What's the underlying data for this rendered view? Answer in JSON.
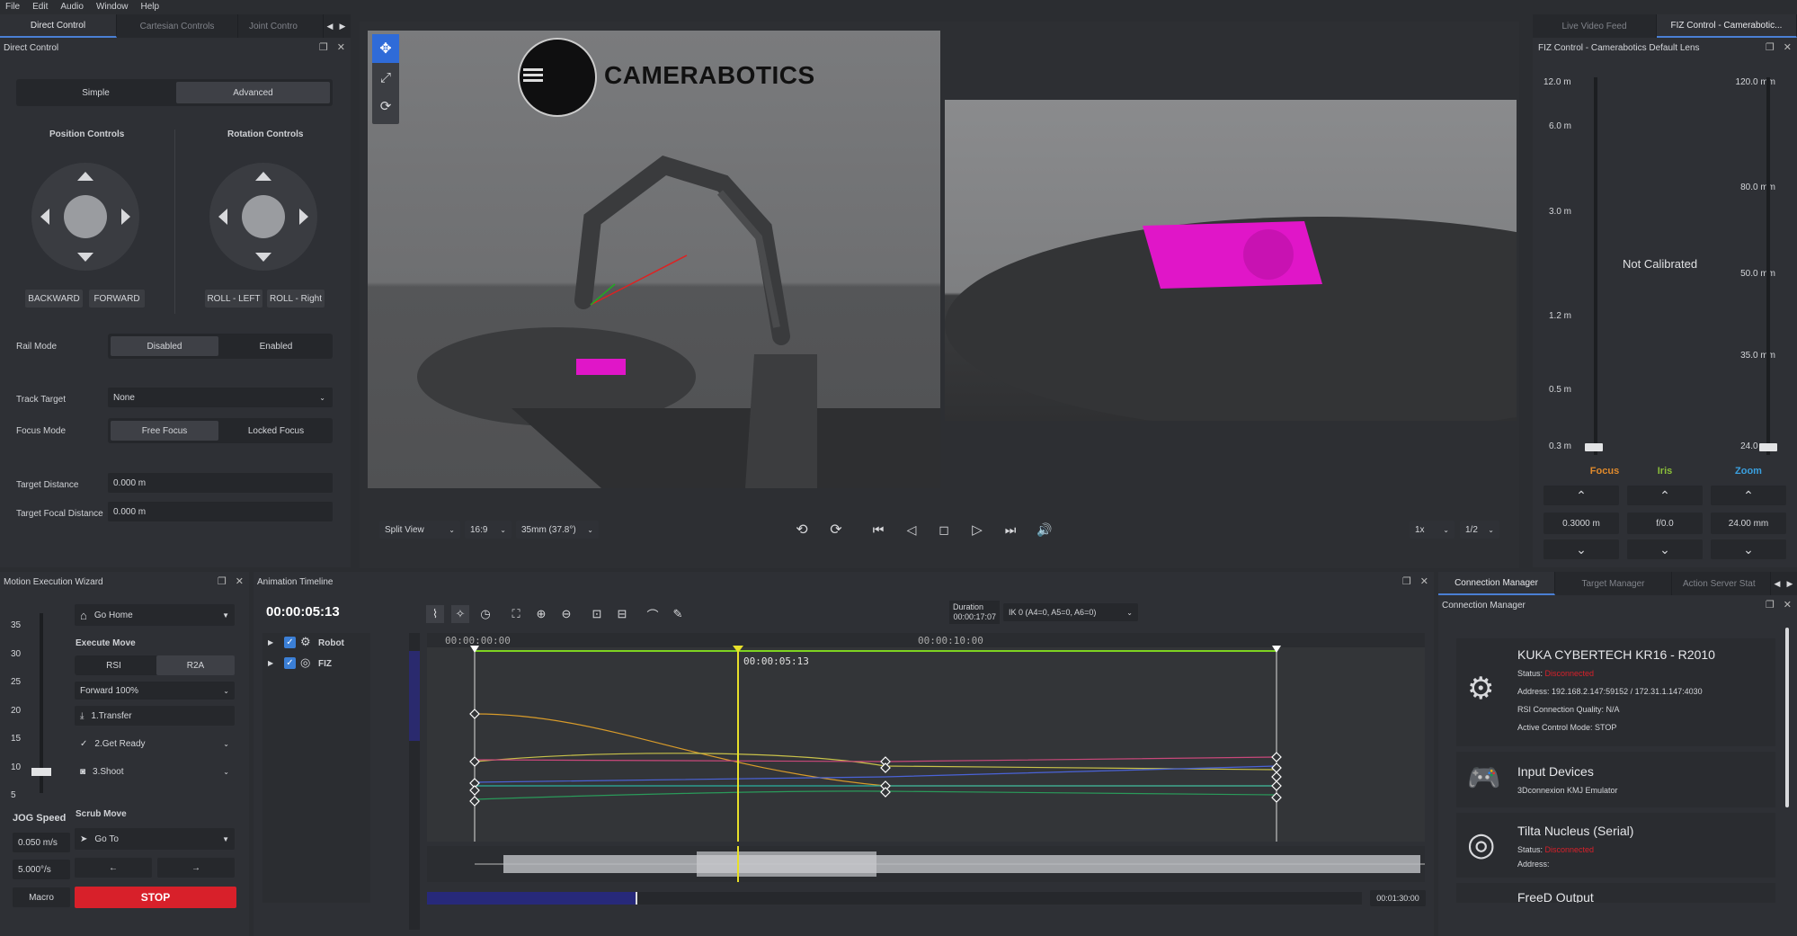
{
  "menu": [
    "File",
    "Edit",
    "Audio",
    "Window",
    "Help"
  ],
  "left_tabs": [
    "Direct Control",
    "Cartesian Controls",
    "Joint Contro"
  ],
  "direct_control": {
    "title": "Direct Control",
    "mode_simple": "Simple",
    "mode_advanced": "Advanced",
    "position_controls": "Position Controls",
    "rotation_controls": "Rotation Controls",
    "backward": "BACKWARD",
    "forward": "FORWARD",
    "roll_left": "ROLL - LEFT",
    "roll_right": "ROLL - Right",
    "rail_mode_label": "Rail Mode",
    "rail_disabled": "Disabled",
    "rail_enabled": "Enabled",
    "track_target_label": "Track Target",
    "track_target_value": "None",
    "focus_mode_label": "Focus Mode",
    "free_focus": "Free Focus",
    "locked_focus": "Locked Focus",
    "target_distance_label": "Target Distance",
    "target_distance_value": "0.000 m",
    "target_focal_label": "Target Focal Distance",
    "target_focal_value": "0.000 m"
  },
  "viewport": {
    "logo_text": "CAMERABOTICS",
    "view_mode": "Split View",
    "aspect": "16:9",
    "lens": "35mm (37.8°)",
    "speed": "1x",
    "fraction": "1/2"
  },
  "right_tabs": [
    "Live Video Feed",
    "FIZ Control - Camerabotic..."
  ],
  "fiz": {
    "title": "FIZ Control - Camerabotics Default Lens",
    "focus_ticks": [
      "12.0 m",
      "6.0 m",
      "3.0 m",
      "1.2 m",
      "0.5 m",
      "0.3 m"
    ],
    "zoom_ticks": [
      "120.0 mm",
      "80.0 mm",
      "50.0 mm",
      "35.0 mm",
      "24.0 mm"
    ],
    "not_calibrated": "Not Calibrated",
    "focus_label": "Focus",
    "iris_label": "Iris",
    "zoom_label": "Zoom",
    "focus_value": "0.3000 m",
    "iris_value": "f/0.0",
    "zoom_value": "24.00 mm",
    "colors": {
      "focus": "#e08a2c",
      "iris": "#8bbf3a",
      "zoom": "#3aa0e0"
    }
  },
  "wizard": {
    "title": "Motion Execution Wizard",
    "scale": [
      "35",
      "30",
      "25",
      "20",
      "15",
      "10",
      "5"
    ],
    "preset": "Go Home",
    "execute_move": "Execute Move",
    "rsi": "RSI",
    "r2a": "R2A",
    "forward_pct": "Forward 100%",
    "step1": "1.Transfer",
    "step2": "2.Get Ready",
    "step3": "3.Shoot",
    "jog_speed": "JOG Speed",
    "scrub_move": "Scrub Move",
    "jog_linear": "0.050 m/s",
    "jog_angular": "5.000°/s",
    "goto": "Go To",
    "left_arrow": "←",
    "right_arrow": "→",
    "macro": "Macro",
    "stop": "STOP"
  },
  "timeline": {
    "title": "Animation Timeline",
    "current_time": "00:00:05:13",
    "track_robot": "Robot",
    "track_fiz": "FIZ",
    "duration_label": "Duration",
    "duration_value": "00:00:17:07",
    "ik_value": "IK 0  (A4=0, A5=0, A6=0)",
    "ruler_start": "00:00:00:00",
    "ruler_mid": "00:00:10:00",
    "playhead_label": "00:00:05:13",
    "total_time": "00:01:30:00"
  },
  "conn_tabs": [
    "Connection Manager",
    "Target Manager",
    "Action Server Stat"
  ],
  "connection": {
    "title": "Connection Manager",
    "robot_name": "KUKA CYBERTECH KR16 - R2010",
    "status_label": "Status:",
    "robot_status": "Disconnected",
    "address": "Address: 192.168.2.147:59152 / 172.31.1.147:4030",
    "rsi_quality": "RSI Connection Quality: N/A",
    "control_mode": "Active Control Mode: STOP",
    "input_title": "Input Devices",
    "input_sub": "3Dconnexion KMJ Emulator",
    "tilta_title": "Tilta Nucleus (Serial)",
    "tilta_status": "Disconnected",
    "tilta_address": "Address:",
    "freed_title": "FreeD Output"
  }
}
